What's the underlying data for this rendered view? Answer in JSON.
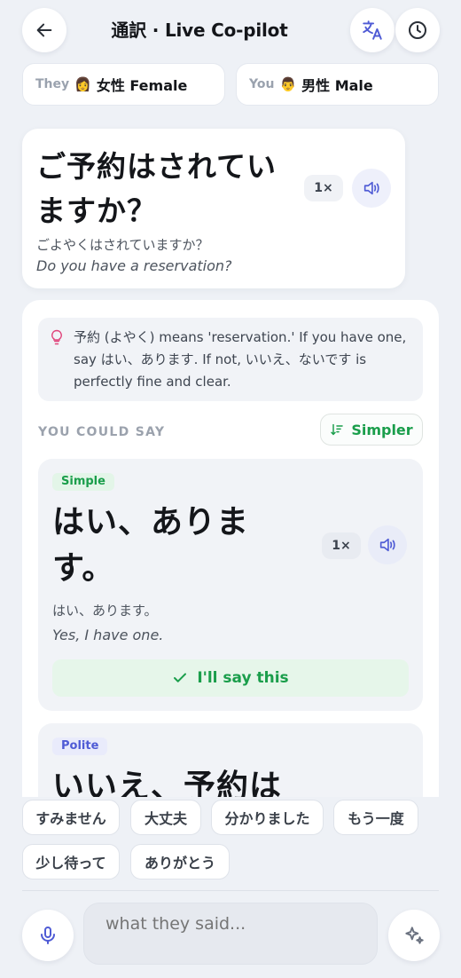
{
  "header": {
    "title": "通訳 · Live Co-pilot"
  },
  "speakers": {
    "them": {
      "role": "They",
      "emoji": "👩",
      "label": "女性 Female"
    },
    "you": {
      "role": "You",
      "emoji": "👨",
      "label": "男性 Male"
    }
  },
  "heard": {
    "japanese_line1": "ご予約はされてい",
    "japanese_line2": "ますか？",
    "kana": "ごよやくはされていますか？",
    "english": "Do you have a reservation?",
    "speed": "1×"
  },
  "tip": {
    "text": "予約 (よやく) means 'reservation.' If you have one, say はい、あります. If not, いいえ、ないです is perfectly fine and clear."
  },
  "suggestions": {
    "section_label": "YOU COULD SAY",
    "simpler_label": "Simpler",
    "items": [
      {
        "tag": "Simple",
        "japanese_line1": "はい、ありま",
        "japanese_line2": "す。",
        "kana": "はい、あります。",
        "english": "Yes, I have one.",
        "speed": "1×",
        "action_label": "I'll say this"
      },
      {
        "tag": "Polite",
        "japanese_line1": "いいえ、予約は"
      }
    ]
  },
  "quick_phrases": [
    "すみません",
    "大丈夫",
    "分かりました",
    "もう一度",
    "少し待って",
    "ありがとう"
  ],
  "composer": {
    "placeholder": "what they said..."
  },
  "colors": {
    "accent_green": "#1a9e4b",
    "accent_indigo": "#4f5bd5",
    "background": "#eef1f6"
  },
  "icons": [
    "back-arrow-icon",
    "translate-icon",
    "history-clock-icon",
    "speaker-icon",
    "lightbulb-icon",
    "sort-down-icon",
    "check-icon",
    "microphone-icon",
    "sparkle-icon"
  ]
}
